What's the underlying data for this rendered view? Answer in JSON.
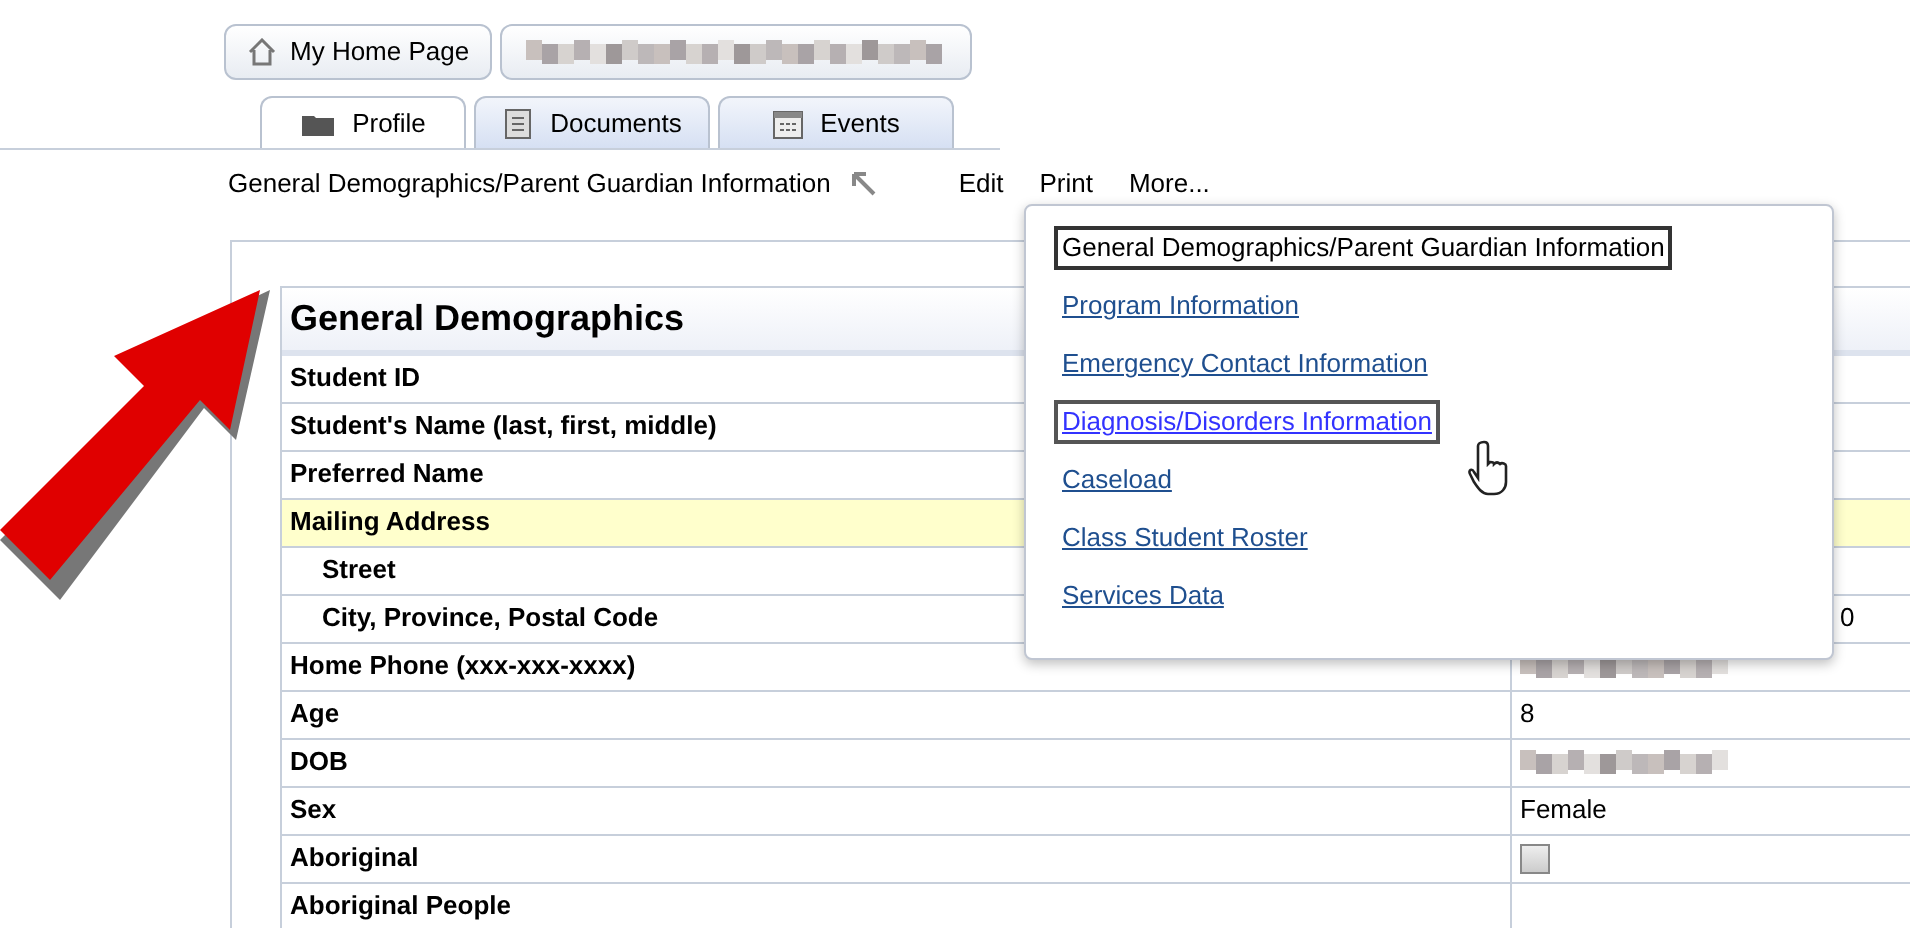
{
  "breadcrumb": [
    {
      "label": "My Home Page",
      "kind": "home"
    },
    {
      "kind": "blurred"
    }
  ],
  "tabs": [
    {
      "label": "Profile",
      "kind": "folder",
      "selected": true
    },
    {
      "label": "Documents",
      "kind": "document",
      "selected": false
    },
    {
      "label": "Events",
      "kind": "calendar",
      "selected": false
    }
  ],
  "toolbar": {
    "title": "General Demographics/Parent Guardian Information",
    "actions": [
      "Edit",
      "Print",
      "More..."
    ]
  },
  "section": {
    "title": "General Demographics",
    "rows": [
      {
        "label": "Student ID",
        "kind": "text"
      },
      {
        "label": "Student's Name (last, first, middle)",
        "kind": "text"
      },
      {
        "label": "Preferred Name",
        "kind": "text"
      },
      {
        "label": "Mailing Address",
        "kind": "group"
      },
      {
        "label": "Street",
        "kind": "sub"
      },
      {
        "label": "City, Province, Postal Code",
        "kind": "sub",
        "value": "0",
        "covered": true
      },
      {
        "label": "Home Phone (xxx-xxx-xxxx)",
        "kind": "blurred"
      },
      {
        "label": "Age",
        "kind": "text",
        "value": "8"
      },
      {
        "label": "DOB",
        "kind": "blurred"
      },
      {
        "label": "Sex",
        "kind": "text",
        "value": "Female"
      },
      {
        "label": "Aboriginal",
        "kind": "checkbox",
        "checked": false
      },
      {
        "label": "Aboriginal People",
        "kind": "text"
      }
    ]
  },
  "menu": {
    "items": [
      {
        "label": "General Demographics/Parent Guardian Information",
        "selected": true,
        "hovered": false
      },
      {
        "label": "Program Information",
        "selected": false,
        "hovered": false
      },
      {
        "label": "Emergency Contact Information",
        "selected": false,
        "hovered": false
      },
      {
        "label": "Diagnosis/Disorders Information",
        "selected": false,
        "hovered": true
      },
      {
        "label": "Caseload",
        "selected": false,
        "hovered": false
      },
      {
        "label": "Class Student Roster",
        "selected": false,
        "hovered": false
      },
      {
        "label": "Services Data",
        "selected": false,
        "hovered": false
      }
    ]
  }
}
